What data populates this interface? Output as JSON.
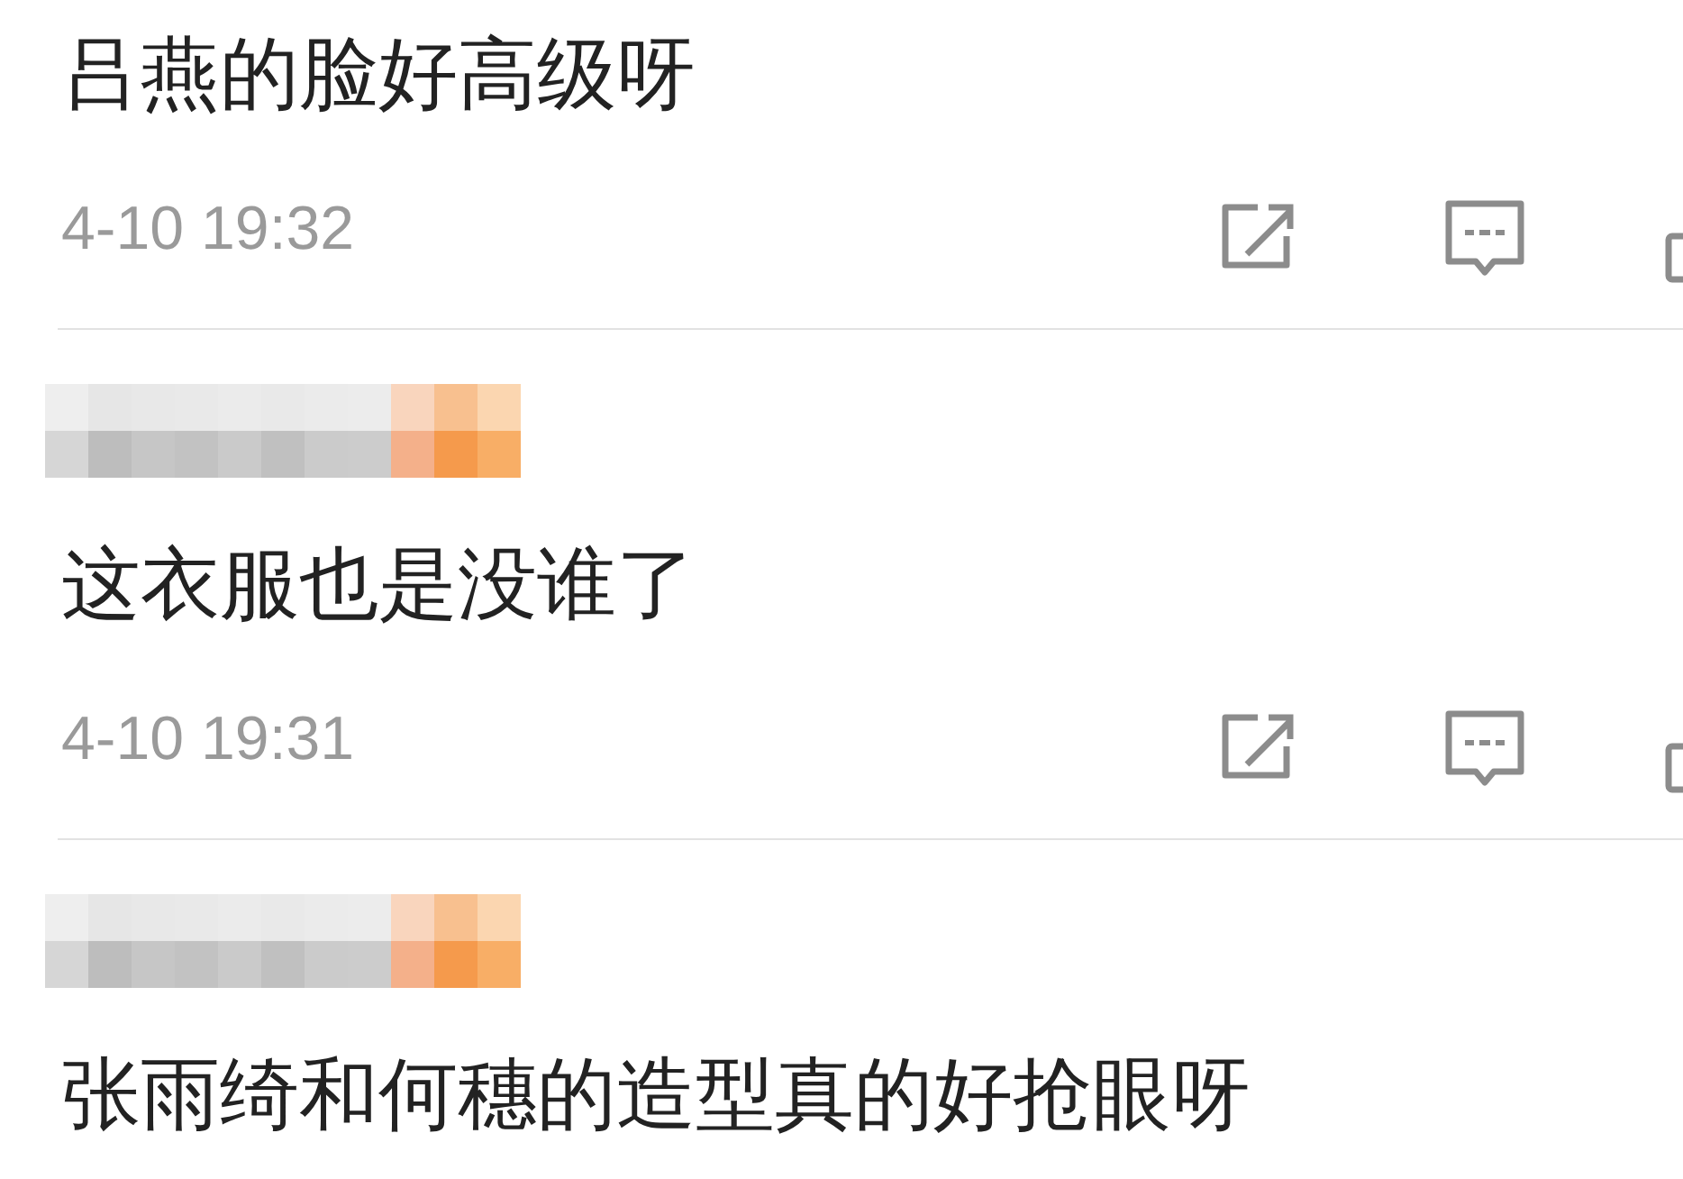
{
  "comments": [
    {
      "masked_name": false,
      "text": "吕燕的脸好高级呀",
      "time": "4-10 19:32"
    },
    {
      "masked_name": true,
      "text": "这衣服也是没谁了",
      "time": "4-10 19:31"
    },
    {
      "masked_name": true,
      "text": "张雨绮和何穗的造型真的好抢眼呀"
    }
  ]
}
